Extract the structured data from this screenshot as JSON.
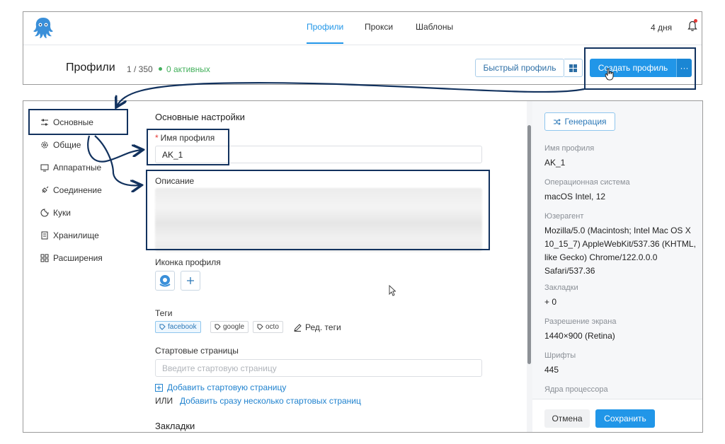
{
  "header": {
    "tabs": [
      {
        "label": "Профили",
        "active": true
      },
      {
        "label": "Прокси",
        "active": false
      },
      {
        "label": "Шаблоны",
        "active": false
      }
    ],
    "days_left": "4 дня",
    "bell_icon": "bell-icon"
  },
  "toolbar": {
    "title": "Профили",
    "count": "1 / 350",
    "active_label": "0 активных",
    "quick_profile_label": "Быстрый профиль",
    "windows_icon": "windows-icon",
    "create_profile_label": "Создать профиль",
    "more_label": "···"
  },
  "sidebar": {
    "items": [
      {
        "label": "Основные",
        "icon": "sliders-icon",
        "active": true
      },
      {
        "label": "Общие",
        "icon": "gear-icon"
      },
      {
        "label": "Аппаратные",
        "icon": "monitor-icon"
      },
      {
        "label": "Соединение",
        "icon": "plug-icon"
      },
      {
        "label": "Куки",
        "icon": "cookie-icon"
      },
      {
        "label": "Хранилище",
        "icon": "storage-icon"
      },
      {
        "label": "Расширения",
        "icon": "grid-icon"
      }
    ]
  },
  "form": {
    "section_title": "Основные настройки",
    "name_label": "Имя профиля",
    "name_value": "AK_1",
    "description_label": "Описание",
    "icon_label": "Иконка профиля",
    "tags_label": "Теги",
    "tags": [
      {
        "label": "facebook",
        "selected": true
      },
      {
        "label": "google",
        "selected": false
      },
      {
        "label": "octo",
        "selected": false
      }
    ],
    "edit_tags_label": "Ред. теги",
    "start_pages_label": "Стартовые страницы",
    "start_page_placeholder": "Введите стартовую страницу",
    "add_start_page_label": "Добавить стартовую страницу",
    "or_label": "ИЛИ",
    "add_multiple_label": "Добавить сразу несколько стартовых страниц",
    "bookmarks_title": "Закладки"
  },
  "summary": {
    "generate_label": "Генерация",
    "fields": [
      {
        "label": "Имя профиля",
        "value": "AK_1"
      },
      {
        "label": "Операционная система",
        "value": "macOS Intel, 12"
      },
      {
        "label": "Юзерагент",
        "value": "Mozilla/5.0 (Macintosh; Intel Mac OS X 10_15_7) AppleWebKit/537.36 (KHTML, like Gecko) Chrome/122.0.0.0 Safari/537.36"
      },
      {
        "label": "Закладки",
        "value": "+ 0"
      },
      {
        "label": "Разрешение экрана",
        "value": "1440×900 (Retina)"
      },
      {
        "label": "Шрифты",
        "value": "445"
      },
      {
        "label": "Ядра процессора",
        "value": ""
      }
    ],
    "cancel_label": "Отмена",
    "save_label": "Сохранить"
  },
  "colors": {
    "accent": "#2196e8",
    "active_green": "#43b05c",
    "annotation": "#12325e"
  }
}
